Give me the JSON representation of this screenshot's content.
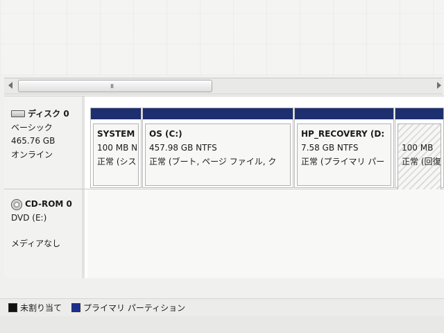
{
  "scrollbar": {
    "grip": "III"
  },
  "disks": [
    {
      "name": "ディスク 0",
      "type": "ベーシック",
      "size": "465.76 GB",
      "status": "オンライン",
      "partitions": [
        {
          "name": "SYSTEM",
          "size": "100 MB N",
          "status": "正常 (シス"
        },
        {
          "name": "OS  (C:)",
          "size": "457.98 GB NTFS",
          "status": "正常 (ブート, ページ ファイル, ク"
        },
        {
          "name": "HP_RECOVERY  (D:",
          "size": "7.58 GB NTFS",
          "status": "正常 (プライマリ パー"
        },
        {
          "name": "",
          "size": "100 MB",
          "status": "正常 (回復"
        }
      ]
    },
    {
      "name": "CD-ROM 0",
      "drive": "DVD (E:)",
      "media": "メディアなし"
    }
  ],
  "legend": [
    {
      "label": "未割り当て",
      "color": "#111111"
    },
    {
      "label": "プライマリ パーティション",
      "color": "#1d2f8e"
    }
  ],
  "colors": {
    "partition_bar": "#1f2c66",
    "panel_bg": "#ffffff"
  }
}
